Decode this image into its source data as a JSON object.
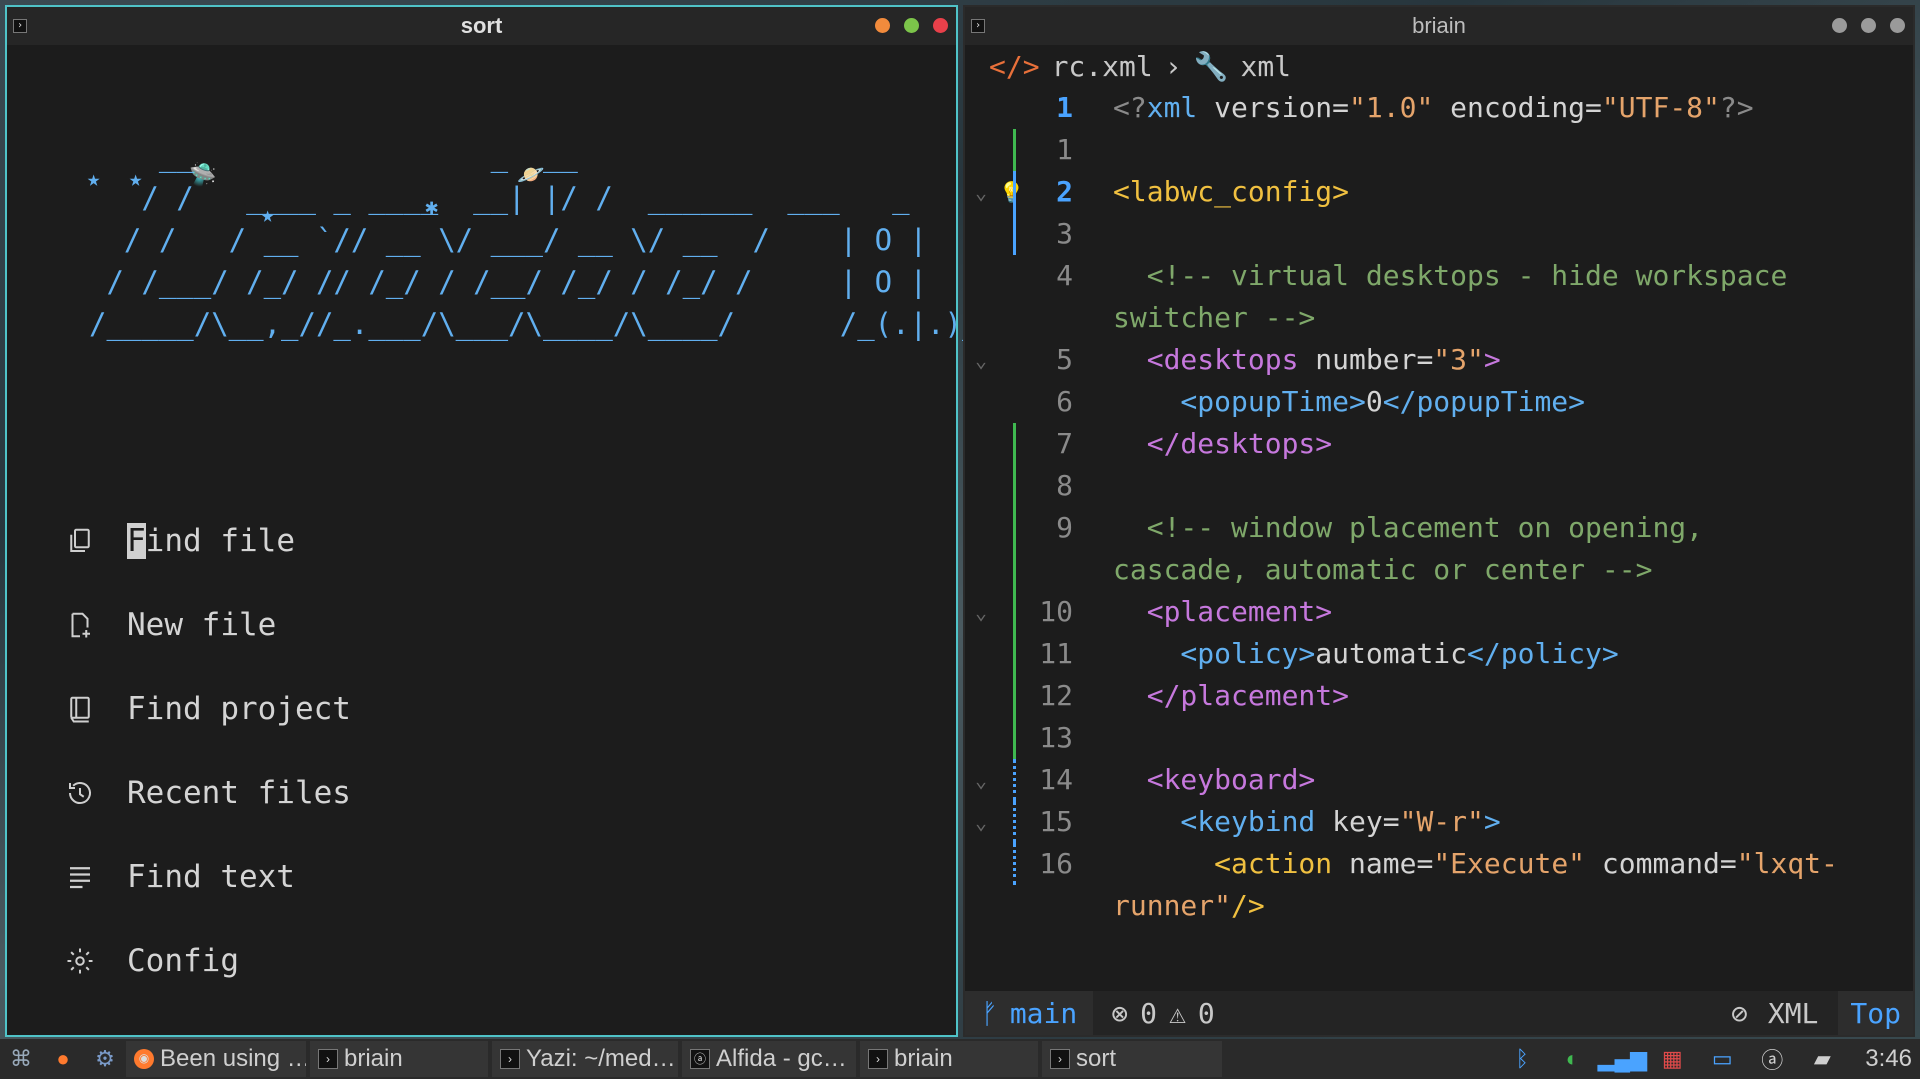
{
  "left_window": {
    "title": "sort",
    "controls": {
      "colors": [
        "#f28b3c",
        "#7cc44a",
        "#e8404a"
      ]
    },
    "ascii_art": "    __                 _  __                     \n   / /   ____ _ ____  __| |/ /  ______  ___   _   \n  / /   / __ `// __ \\/ ___/ __ \\/ __  /    | O |  \n / /___/ /_/ // /_/ / /__/ /_/ / /_/ /     | O |  \n/_____/\\__,_//_.___/\\___/\\____/\\____/      /_(.|.)_\\",
    "menu": [
      {
        "icon": "copy-icon",
        "label": "Find file"
      },
      {
        "icon": "new-file-icon",
        "label": "New file"
      },
      {
        "icon": "project-icon",
        "label": "Find project"
      },
      {
        "icon": "history-icon",
        "label": "Recent files"
      },
      {
        "icon": "lines-icon",
        "label": "Find text"
      },
      {
        "icon": "gear-icon",
        "label": "Config"
      }
    ]
  },
  "right_window": {
    "title": "briain",
    "controls": {
      "colors": [
        "#9a9a9a",
        "#9a9a9a",
        "#9a9a9a"
      ]
    },
    "breadcrumb": {
      "file": "rc.xml",
      "symbol": "xml"
    },
    "lines": [
      {
        "n": "1",
        "cur": true,
        "parts": [
          [
            "pi",
            "<?"
          ],
          [
            "nm",
            "xml"
          ],
          [
            "at",
            " version="
          ],
          [
            "sv",
            "\"1.0\""
          ],
          [
            "at",
            " encoding="
          ],
          [
            "sv",
            "\"UTF-8\""
          ],
          [
            "pi",
            "?>"
          ]
        ]
      },
      {
        "n": "1",
        "parts": []
      },
      {
        "n": "2",
        "cur": true,
        "parts": [
          [
            "yl",
            "<labwc_config>"
          ]
        ]
      },
      {
        "n": "3",
        "parts": []
      },
      {
        "n": "4",
        "parts": [
          [
            "cm",
            "  <!-- virtual desktops - hide workspace"
          ]
        ]
      },
      {
        "n": "",
        "parts": [
          [
            "cm",
            "switcher -->"
          ]
        ]
      },
      {
        "n": "5",
        "parts": [
          [
            "tg",
            "  <desktops"
          ],
          [
            "at",
            " number="
          ],
          [
            "sv",
            "\"3\""
          ],
          [
            "tg",
            ">"
          ]
        ]
      },
      {
        "n": "6",
        "parts": [
          [
            "nm",
            "    <popupTime>"
          ],
          [
            "at",
            "0"
          ],
          [
            "nm",
            "</popupTime>"
          ]
        ]
      },
      {
        "n": "7",
        "parts": [
          [
            "tg",
            "  </desktops>"
          ]
        ]
      },
      {
        "n": "8",
        "parts": []
      },
      {
        "n": "9",
        "parts": [
          [
            "cm",
            "  <!-- window placement on opening,"
          ]
        ]
      },
      {
        "n": "",
        "parts": [
          [
            "cm",
            "cascade, automatic or center -->"
          ]
        ]
      },
      {
        "n": "10",
        "parts": [
          [
            "tg",
            "  <placement>"
          ]
        ]
      },
      {
        "n": "11",
        "parts": [
          [
            "nm",
            "    <policy>"
          ],
          [
            "at",
            "automatic"
          ],
          [
            "nm",
            "</policy>"
          ]
        ]
      },
      {
        "n": "12",
        "parts": [
          [
            "tg",
            "  </placement>"
          ]
        ]
      },
      {
        "n": "13",
        "parts": []
      },
      {
        "n": "14",
        "parts": [
          [
            "tg",
            "  <keyboard>"
          ]
        ]
      },
      {
        "n": "15",
        "parts": [
          [
            "nm",
            "    <keybind"
          ],
          [
            "at",
            " key="
          ],
          [
            "sv",
            "\"W-r\""
          ],
          [
            "nm",
            ">"
          ]
        ]
      },
      {
        "n": "16",
        "parts": [
          [
            "yl",
            "      <action"
          ],
          [
            "at",
            " name="
          ],
          [
            "sv",
            "\"Execute\""
          ],
          [
            "at",
            " command="
          ],
          [
            "sv",
            "\"lxqt-"
          ]
        ]
      },
      {
        "n": "",
        "parts": [
          [
            "sv",
            "runner\""
          ],
          [
            "yl",
            "/>"
          ]
        ]
      }
    ],
    "status": {
      "branch": "main",
      "errors": "0",
      "warnings": "0",
      "filetype": "XML",
      "position": "Top"
    }
  },
  "taskbar": {
    "tasks": [
      {
        "icon": "firefox-icon",
        "label": "Been using …"
      },
      {
        "icon": "terminal-icon",
        "label": "briain"
      },
      {
        "icon": "terminal-icon",
        "label": "Yazi: ~/med…"
      },
      {
        "icon": "alfida-icon",
        "label": "Alfida - gc…"
      },
      {
        "icon": "terminal-icon",
        "label": "briain"
      },
      {
        "icon": "terminal-icon",
        "label": "sort"
      }
    ],
    "clock": "3:46"
  }
}
